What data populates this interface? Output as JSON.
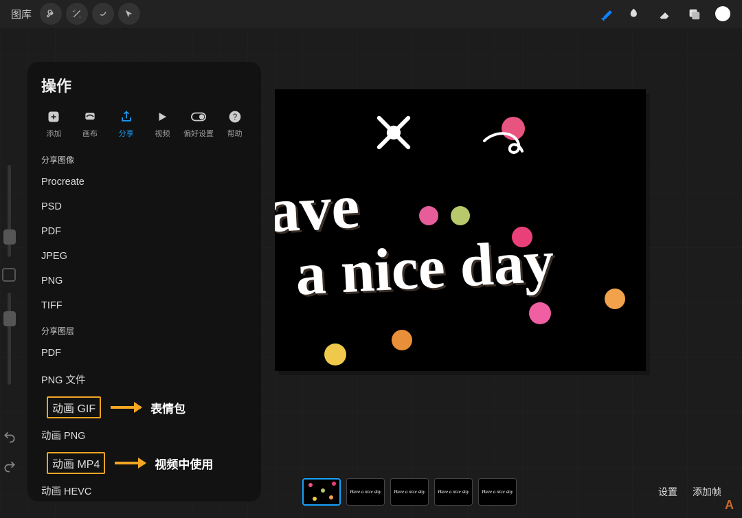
{
  "topbar": {
    "gallery": "图库"
  },
  "popover": {
    "title": "操作",
    "tabs": [
      {
        "label": "添加"
      },
      {
        "label": "画布"
      },
      {
        "label": "分享"
      },
      {
        "label": "视频"
      },
      {
        "label": "偏好设置"
      },
      {
        "label": "帮助"
      }
    ],
    "share_image_header": "分享图像",
    "share_image_items": [
      "Procreate",
      "PSD",
      "PDF",
      "JPEG",
      "PNG",
      "TIFF"
    ],
    "share_layer_header": "分享图层",
    "share_layer_items": {
      "pdf": "PDF",
      "png_files": "PNG 文件",
      "anim_gif": "动画 GIF",
      "anim_png": "动画 PNG",
      "anim_mp4": "动画 MP4",
      "anim_hevc": "动画 HEVC"
    }
  },
  "annotations": {
    "gif": "表情包",
    "mp4": "视频中使用"
  },
  "art": {
    "line1": "ave",
    "line2": "a nice day"
  },
  "timeline": {
    "frame_label": "Have a nice day",
    "settings": "设置",
    "add_frame": "添加帧"
  },
  "chart_data": {
    "type": "table",
    "title": "Procreate Actions → Share export formats",
    "categories": [
      "分享图像",
      "分享图层"
    ],
    "series": [
      {
        "name": "分享图像",
        "values": [
          "Procreate",
          "PSD",
          "PDF",
          "JPEG",
          "PNG",
          "TIFF"
        ]
      },
      {
        "name": "分享图层",
        "values": [
          "PDF",
          "PNG 文件",
          "动画 GIF",
          "动画 PNG",
          "动画 MP4",
          "动画 HEVC"
        ]
      }
    ]
  }
}
